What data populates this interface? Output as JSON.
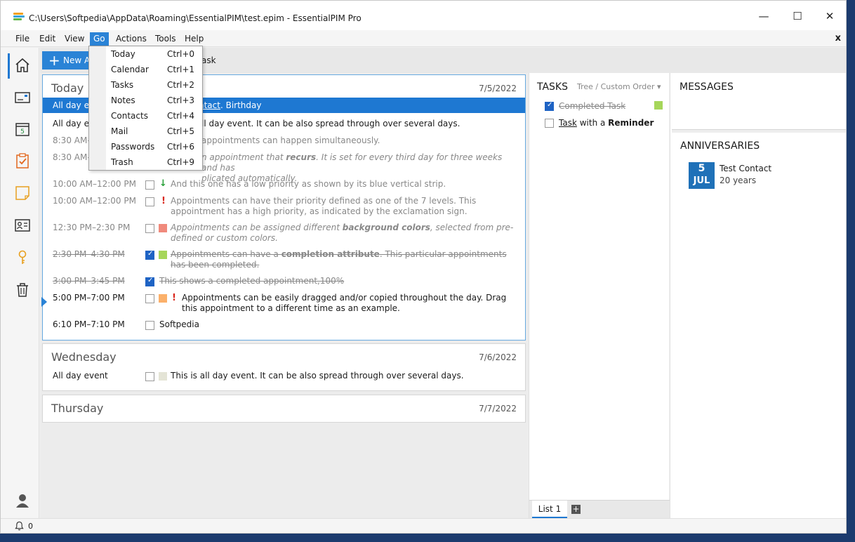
{
  "window": {
    "title": "C:\\Users\\Softpedia\\AppData\\Roaming\\EssentialPIM\\test.epim - EssentialPIM Pro",
    "minimize": "—",
    "maximize": "☐",
    "close": "✕"
  },
  "menu": {
    "items": [
      "File",
      "Edit",
      "View",
      "Go",
      "Actions",
      "Tools",
      "Help"
    ],
    "close_label": "x"
  },
  "go_menu": {
    "items": [
      {
        "label": "Today",
        "shortcut": "Ctrl+0"
      },
      {
        "label": "Calendar",
        "shortcut": "Ctrl+1"
      },
      {
        "label": "Tasks",
        "shortcut": "Ctrl+2"
      },
      {
        "label": "Notes",
        "shortcut": "Ctrl+3"
      },
      {
        "label": "Contacts",
        "shortcut": "Ctrl+4"
      },
      {
        "label": "Mail",
        "shortcut": "Ctrl+5"
      },
      {
        "label": "Passwords",
        "shortcut": "Ctrl+6"
      },
      {
        "label": "Trash",
        "shortcut": "Ctrl+9"
      }
    ]
  },
  "toolbar": {
    "new_label": "New A",
    "task_label": "ask"
  },
  "sidebar": {
    "icons": [
      "home-icon",
      "mail-icon",
      "calendar-icon",
      "tasks-icon",
      "notes-icon",
      "contacts-icon",
      "passwords-icon",
      "trash-icon",
      "user-icon"
    ],
    "calendar_day": "5"
  },
  "today": {
    "title": "Today",
    "date": "7/5/2022",
    "rows": [
      {
        "time": "All day e",
        "desc": "ntact",
        "desc_suffix": ". Birthday"
      },
      {
        "time": "All day e",
        "desc": "ll day event. It can be also spread through over several days."
      },
      {
        "time": "8:30 AM–",
        "desc": "appointments can happen simultaneously."
      },
      {
        "time": "8:30 AM–",
        "desc_a": "n appointment that ",
        "desc_b": "recurs",
        "desc_c": ". It is set for every third day for three weeks and has",
        "desc_d": "plicated automatically."
      },
      {
        "time": "10:00 AM–12:00 PM",
        "desc": "And this one has a low priority as shown by its blue vertical strip."
      },
      {
        "time": "10:00 AM–12:00 PM",
        "desc": "Appointments can have their priority defined as one of the 7 levels. This appointment has a high priority, as indicated by the exclamation sign."
      },
      {
        "time": "12:30 PM–2:30 PM",
        "desc_a": "Appointments can be assigned different ",
        "desc_b": "background colors",
        "desc_c": ", selected from pre-defined or custom colors."
      },
      {
        "time": "2:30 PM–4:30 PM",
        "desc_a": "Appointments can have a ",
        "desc_b": "completion attribute",
        "desc_c": ". This particular appointments has been completed."
      },
      {
        "time": "3:00 PM–3:45 PM",
        "desc": "This shows a completed appointment,100%"
      },
      {
        "time": "5:00 PM–7:00 PM",
        "desc": "Appointments can be easily dragged and/or copied throughout the day. Drag this appointment to a different time as an example."
      },
      {
        "time": "6:10 PM–7:10 PM",
        "desc": "Softpedia"
      }
    ]
  },
  "wednesday": {
    "title": "Wednesday",
    "date": "7/6/2022",
    "time": "All day event",
    "desc": "This is all day event. It can be also spread through over several days."
  },
  "thursday": {
    "title": "Thursday",
    "date": "7/7/2022"
  },
  "tasks": {
    "header": "TASKS",
    "order": "Tree / Custom Order",
    "items": [
      {
        "label": "Completed Task",
        "done": true
      },
      {
        "label_a": "Task",
        "label_b": " with a ",
        "label_c": "Reminder",
        "done": false
      }
    ],
    "tab": "List 1",
    "add_tab": "+"
  },
  "messages": {
    "header": "MESSAGES"
  },
  "anniversaries": {
    "header": "ANNIVERSARIES",
    "day": "5",
    "month": "JUL",
    "name": "Test Contact",
    "years": "20 years"
  },
  "status": {
    "count": "0"
  },
  "colors": {
    "accent": "#2a83d6",
    "swatch_red": "#f08a7c",
    "swatch_green": "#a6d65a",
    "swatch_orange": "#fbb06a",
    "swatch_beige": "#e4e4d6"
  }
}
